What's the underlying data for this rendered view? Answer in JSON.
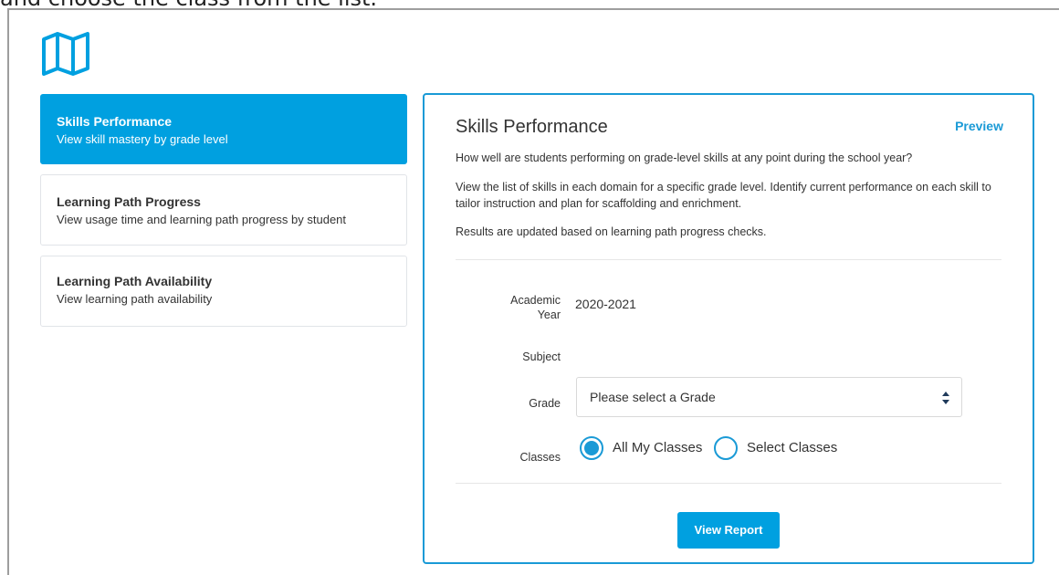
{
  "caption": "and choose the class from the list.",
  "sidebar": {
    "items": [
      {
        "title": "Skills Performance",
        "desc": "View skill mastery by grade level"
      },
      {
        "title": "Learning Path Progress",
        "desc": "View usage time and learning path progress by student"
      },
      {
        "title": "Learning Path Availability",
        "desc": "View learning path availability"
      }
    ]
  },
  "panel": {
    "title": "Skills Performance",
    "preview": "Preview",
    "desc1": "How well are students performing on grade-level skills at any point during the school year?",
    "desc2": "View the list of skills in each domain for a specific grade level. Identify current performance on each skill to tailor instruction and plan for scaffolding and enrichment.",
    "desc3": "Results are updated based on learning path progress checks."
  },
  "form": {
    "academic_year_label": "Academic Year",
    "academic_year_value": "2020-2021",
    "subject_label": "Subject",
    "grade_label": "Grade",
    "grade_placeholder": "Please select a Grade",
    "classes_label": "Classes",
    "radio_all": "All My Classes",
    "radio_select": "Select Classes",
    "view_report": "View Report"
  },
  "colors": {
    "accent": "#00a0e0",
    "panel_border": "#1a9ad6"
  },
  "icons": {
    "logo": "map-icon",
    "select_caret": "sort-caret-icon"
  }
}
